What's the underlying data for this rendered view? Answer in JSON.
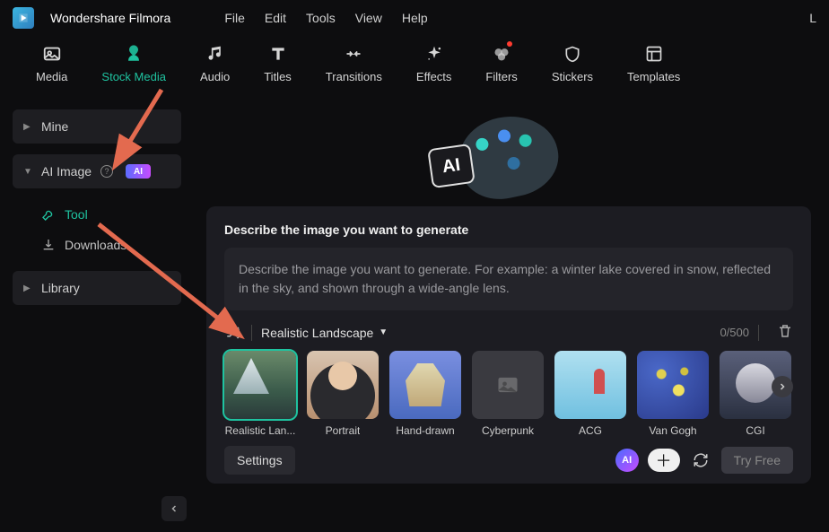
{
  "app": {
    "title": "Wondershare Filmora"
  },
  "menus": {
    "file": "File",
    "edit": "Edit",
    "tools": "Tools",
    "view": "View",
    "help": "Help"
  },
  "toolbar": {
    "media": "Media",
    "stock_media": "Stock Media",
    "audio": "Audio",
    "titles": "Titles",
    "transitions": "Transitions",
    "effects": "Effects",
    "filters": "Filters",
    "stickers": "Stickers",
    "templates": "Templates"
  },
  "sidebar": {
    "mine": "Mine",
    "ai_image": "AI Image",
    "ai_badge": "AI",
    "tool": "Tool",
    "downloads": "Downloads",
    "library": "Library"
  },
  "hero": {
    "ai_label": "AI"
  },
  "card": {
    "title": "Describe the image you want to generate",
    "placeholder": "Describe the image you want to generate. For example: a winter lake covered in snow, reflected in the sky, and shown through a wide-angle lens.",
    "style_selected": "Realistic Landscape",
    "char_count": "0/500"
  },
  "styles": [
    {
      "label": "Realistic Lan...",
      "selected": true,
      "thumb": "landscape"
    },
    {
      "label": "Portrait",
      "selected": false,
      "thumb": "portrait"
    },
    {
      "label": "Hand-drawn",
      "selected": false,
      "thumb": "hand"
    },
    {
      "label": "Cyberpunk",
      "selected": false,
      "thumb": "cyber"
    },
    {
      "label": "ACG",
      "selected": false,
      "thumb": "acg"
    },
    {
      "label": "Van Gogh",
      "selected": false,
      "thumb": "vangogh"
    },
    {
      "label": "CGI",
      "selected": false,
      "thumb": "cgi"
    }
  ],
  "bottom": {
    "settings": "Settings",
    "try_free": "Try Free"
  }
}
